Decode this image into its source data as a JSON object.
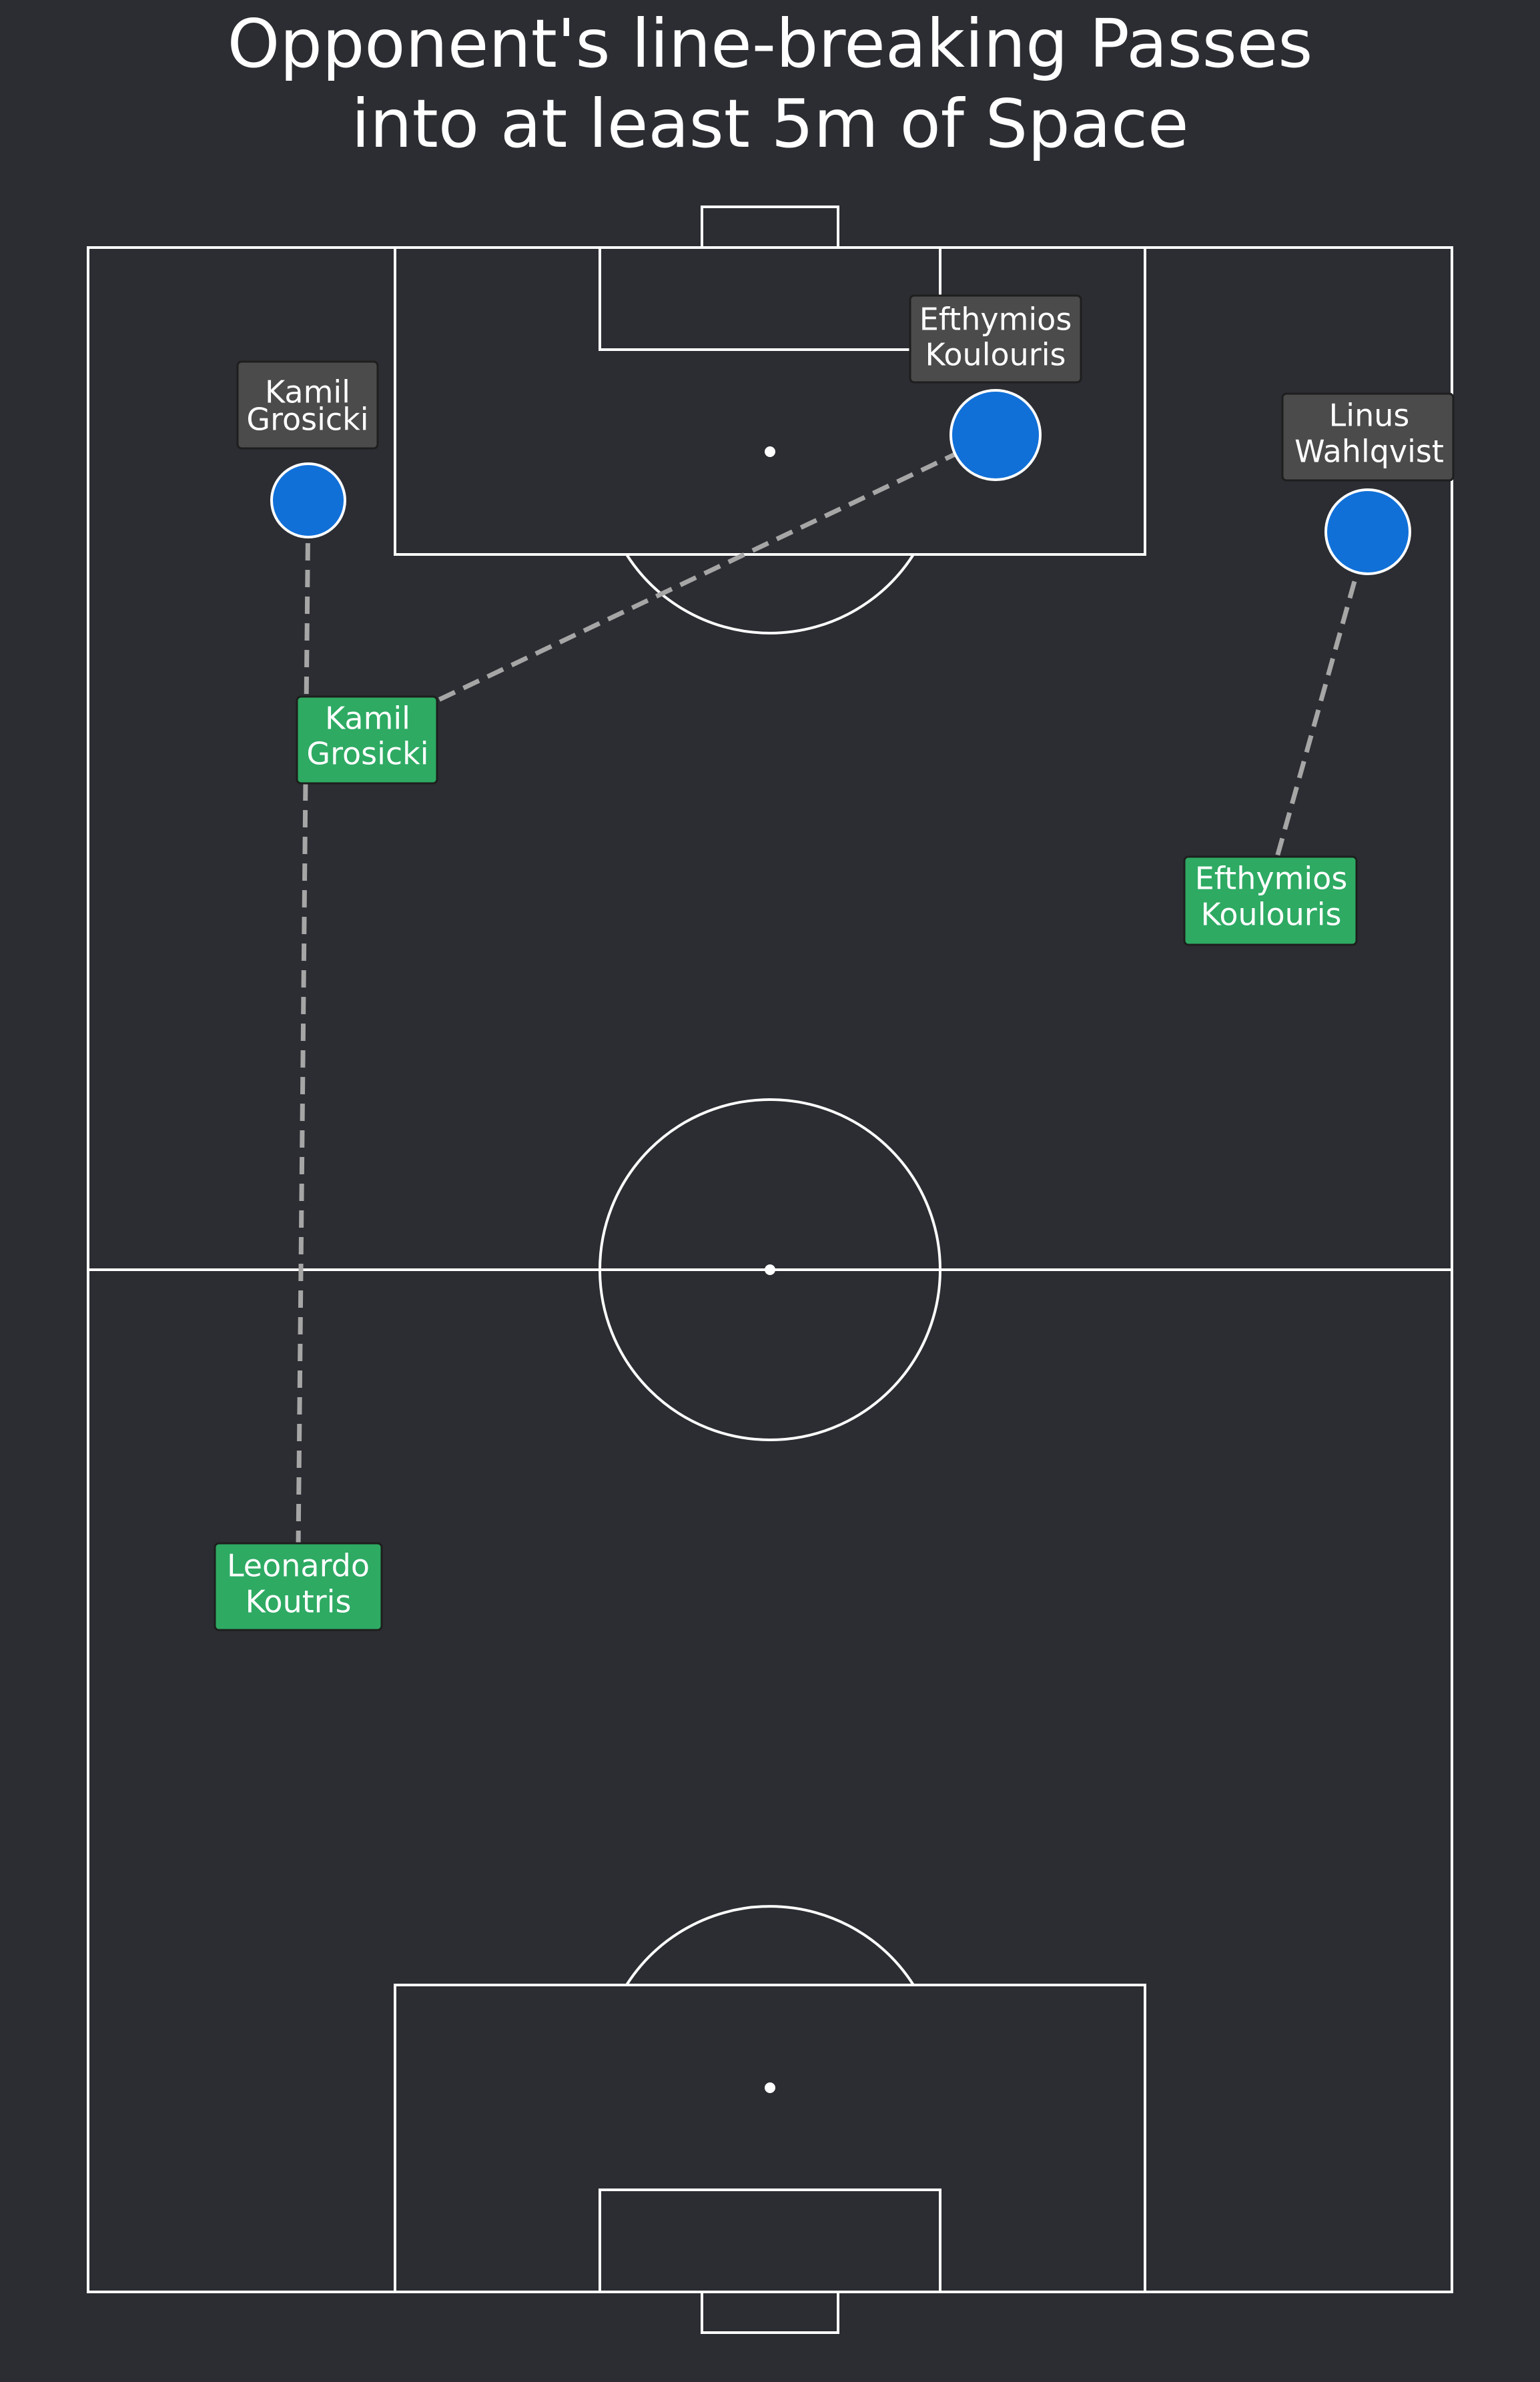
{
  "title": {
    "line1": "Opponent's line-breaking Passes",
    "line2": "into at least 5m of Space"
  },
  "colors": {
    "background": "#2c2d32",
    "pitch_lines": "#ffffff",
    "pass_line": "#a6a6a6",
    "passer_box": "#2eaa63",
    "receiver_box": "#4b4b4b",
    "receiver_dot": "#1170d8"
  },
  "passes": [
    {
      "passer": [
        "Leonardo",
        "Koutris"
      ],
      "receiver": [
        "Kamil",
        "Grosicki"
      ]
    },
    {
      "passer": [
        "Kamil",
        "Grosicki"
      ],
      "receiver": [
        "Efthymios",
        "Koulouris"
      ]
    },
    {
      "passer": [
        "Efthymios",
        "Koulouris"
      ],
      "receiver": [
        "Linus",
        "Wahlqvist"
      ]
    }
  ]
}
